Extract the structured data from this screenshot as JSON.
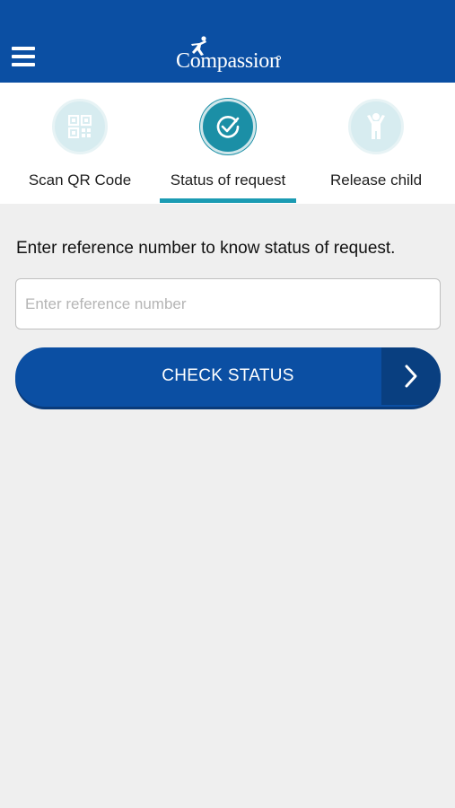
{
  "header": {
    "logo_text": "Compassion",
    "brand_color": "#0b4fa3"
  },
  "tabs": [
    {
      "label": "Scan QR Code",
      "icon": "qr-code-icon",
      "active": false
    },
    {
      "label": "Status of request",
      "icon": "check-circle-icon",
      "active": true
    },
    {
      "label": "Release child",
      "icon": "child-icon",
      "active": false
    }
  ],
  "main": {
    "instruction": "Enter reference number to know status of request.",
    "reference_input": {
      "value": "",
      "placeholder": "Enter reference number"
    },
    "check_button_label": "CHECK STATUS"
  },
  "colors": {
    "accent": "#1b9bb3",
    "background": "#efefef"
  }
}
